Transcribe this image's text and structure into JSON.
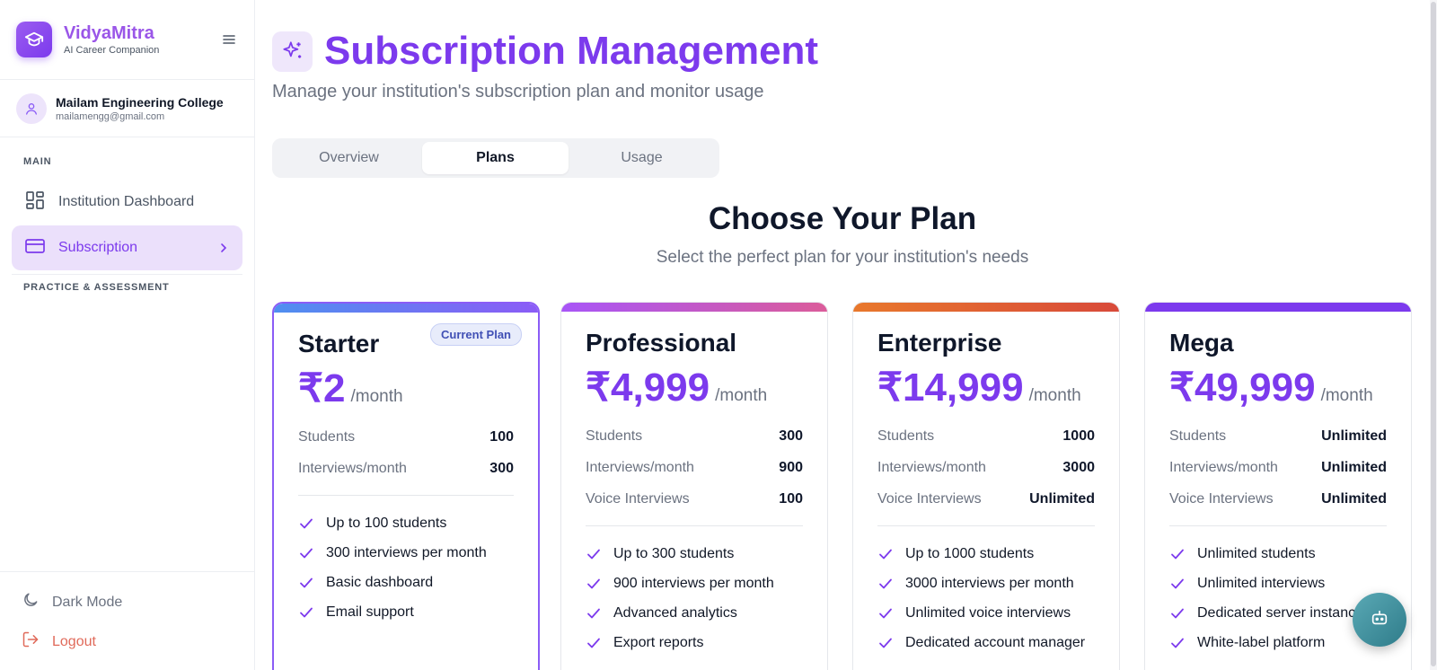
{
  "brand": {
    "name": "VidyaMitra",
    "tagline": "AI Career Companion"
  },
  "profile": {
    "name": "Mailam Engineering College",
    "email": "mailamengg@gmail.com"
  },
  "sidebar": {
    "section_main": "MAIN",
    "items": [
      {
        "label": "Institution Dashboard",
        "icon": "dashboard-grid-icon",
        "active": false
      },
      {
        "label": "Subscription",
        "icon": "credit-card-icon",
        "active": true
      }
    ],
    "section_practice": "PRACTICE & ASSESSMENT",
    "dark_mode": "Dark Mode",
    "logout": "Logout"
  },
  "page": {
    "title": "Subscription Management",
    "subtitle": "Manage your institution's subscription plan and monitor usage"
  },
  "tabs": [
    {
      "label": "Overview",
      "active": false
    },
    {
      "label": "Plans",
      "active": true
    },
    {
      "label": "Usage",
      "active": false
    }
  ],
  "plans_section": {
    "title": "Choose Your Plan",
    "subtitle": "Select the perfect plan for your institution's needs"
  },
  "plans": [
    {
      "name": "Starter",
      "price": "₹2",
      "period": "/month",
      "badge": "Current Plan",
      "current": true,
      "accent": [
        "#4f8ff0",
        "#8b5cf6"
      ],
      "stats": [
        {
          "label": "Students",
          "value": "100"
        },
        {
          "label": "Interviews/month",
          "value": "300"
        }
      ],
      "features": [
        "Up to 100 students",
        "300 interviews per month",
        "Basic dashboard",
        "Email support"
      ]
    },
    {
      "name": "Professional",
      "price": "₹4,999",
      "period": "/month",
      "current": false,
      "accent": [
        "#a855f7",
        "#db5c9a"
      ],
      "stats": [
        {
          "label": "Students",
          "value": "300"
        },
        {
          "label": "Interviews/month",
          "value": "900"
        },
        {
          "label": "Voice Interviews",
          "value": "100"
        }
      ],
      "features": [
        "Up to 300 students",
        "900 interviews per month",
        "Advanced analytics",
        "Export reports"
      ]
    },
    {
      "name": "Enterprise",
      "price": "₹14,999",
      "period": "/month",
      "current": false,
      "accent": [
        "#e8782c",
        "#d84a3a"
      ],
      "stats": [
        {
          "label": "Students",
          "value": "1000"
        },
        {
          "label": "Interviews/month",
          "value": "3000"
        },
        {
          "label": "Voice Interviews",
          "value": "Unlimited"
        }
      ],
      "features": [
        "Up to 1000 students",
        "3000 interviews per month",
        "Unlimited voice interviews",
        "Dedicated account manager"
      ]
    },
    {
      "name": "Mega",
      "price": "₹49,999",
      "period": "/month",
      "current": false,
      "accent": [
        "#7c3aed",
        "#7c3aed"
      ],
      "stats": [
        {
          "label": "Students",
          "value": "Unlimited"
        },
        {
          "label": "Interviews/month",
          "value": "Unlimited"
        },
        {
          "label": "Voice Interviews",
          "value": "Unlimited"
        }
      ],
      "features": [
        "Unlimited students",
        "Unlimited interviews",
        "Dedicated server instance",
        "White-label platform"
      ]
    }
  ],
  "colors": {
    "primary": "#7c3aed",
    "brand_text": "#9a56e8",
    "active_nav_bg": "#ebe0fb",
    "logout": "#e06a5a",
    "fab": "#3f8f9c"
  }
}
